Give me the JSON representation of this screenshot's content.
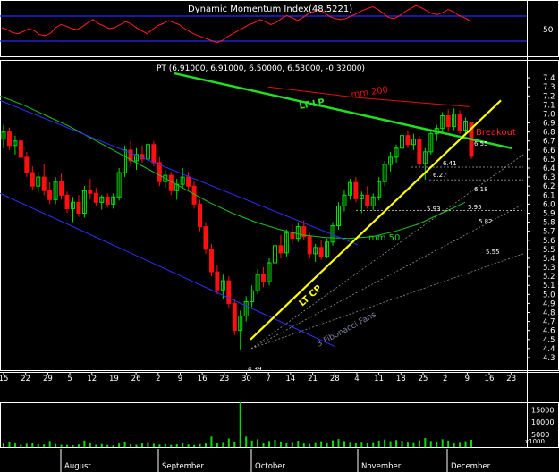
{
  "chart_data": [
    {
      "panel": "momentum",
      "type": "line",
      "title": "Dynamic Momentum Index(48.5221)",
      "ref_label": "50",
      "ylim": [
        0,
        100
      ],
      "upper_band": 75,
      "lower_band": 25,
      "color": "#ff2020",
      "band_color": "#2b2bff",
      "values": [
        52,
        48,
        42,
        40,
        44,
        50,
        46,
        38,
        36,
        40,
        52,
        58,
        55,
        50,
        48,
        54,
        62,
        68,
        60,
        55,
        50,
        52,
        58,
        64,
        60,
        52,
        46,
        40,
        48,
        56,
        60,
        66,
        62,
        58,
        50,
        44,
        38,
        34,
        30,
        26,
        22,
        26,
        34,
        40,
        46,
        52,
        58,
        62,
        68,
        64,
        58,
        62,
        70,
        76,
        72,
        66,
        72,
        80,
        84,
        88,
        82,
        74,
        70,
        68,
        70,
        75,
        80,
        86,
        90,
        94,
        88,
        80,
        72,
        70,
        76,
        84,
        90,
        96,
        92,
        86,
        80,
        78,
        82,
        88,
        84,
        76,
        72,
        66
      ]
    },
    {
      "panel": "price",
      "type": "candlestick",
      "title": "PT (6.91000, 6.91000, 6.50000, 6.53000, -0.32000)",
      "ylim": [
        4.25,
        7.5
      ],
      "y_ticks": [
        "7.4",
        "7.3",
        "7.2",
        "7.1",
        "7.0",
        "6.9",
        "6.8",
        "6.7",
        "6.6",
        "6.5",
        "6.4",
        "6.3",
        "6.2",
        "6.1",
        "6.0",
        "5.9",
        "5.8",
        "5.7",
        "5.6",
        "5.5",
        "5.4",
        "5.3",
        "5.2",
        "5.1",
        "5.0",
        "4.9",
        "4.8",
        "4.7",
        "4.6",
        "4.5",
        "4.4",
        "4.3"
      ],
      "x_ticks": [
        "15",
        "22",
        "29",
        "5",
        "12",
        "19",
        "26",
        "2",
        "9",
        "16",
        "23",
        "30",
        "7",
        "14",
        "21",
        "28",
        "4",
        "11",
        "18",
        "25",
        "2",
        "9",
        "16",
        "23"
      ],
      "months": [
        "August",
        "September",
        "October",
        "November",
        "December"
      ],
      "up_color": "#00e000",
      "down_color": "#ff1010",
      "candles": [
        [
          6.72,
          6.88,
          6.62,
          6.8
        ],
        [
          6.8,
          6.85,
          6.6,
          6.65
        ],
        [
          6.65,
          6.76,
          6.55,
          6.7
        ],
        [
          6.7,
          6.74,
          6.48,
          6.52
        ],
        [
          6.52,
          6.58,
          6.3,
          6.35
        ],
        [
          6.35,
          6.42,
          6.15,
          6.2
        ],
        [
          6.2,
          6.36,
          6.12,
          6.3
        ],
        [
          6.3,
          6.44,
          6.1,
          6.15
        ],
        [
          6.15,
          6.24,
          6.0,
          6.05
        ],
        [
          6.05,
          6.3,
          6.0,
          6.25
        ],
        [
          6.25,
          6.34,
          6.05,
          6.1
        ],
        [
          6.1,
          6.14,
          5.9,
          5.95
        ],
        [
          5.95,
          6.08,
          5.8,
          6.02
        ],
        [
          6.02,
          6.1,
          5.86,
          5.9
        ],
        [
          5.9,
          6.2,
          5.85,
          6.15
        ],
        [
          6.15,
          6.28,
          6.05,
          6.12
        ],
        [
          6.12,
          6.18,
          5.98,
          6.02
        ],
        [
          6.02,
          6.1,
          5.94,
          6.08
        ],
        [
          6.08,
          6.12,
          5.96,
          6.0
        ],
        [
          6.0,
          6.12,
          5.95,
          6.08
        ],
        [
          6.08,
          6.4,
          6.04,
          6.35
        ],
        [
          6.35,
          6.65,
          6.3,
          6.6
        ],
        [
          6.6,
          6.7,
          6.42,
          6.48
        ],
        [
          6.48,
          6.62,
          6.38,
          6.55
        ],
        [
          6.55,
          6.65,
          6.46,
          6.5
        ],
        [
          6.5,
          6.72,
          6.45,
          6.66
        ],
        [
          6.66,
          6.7,
          6.42,
          6.46
        ],
        [
          6.46,
          6.52,
          6.2,
          6.25
        ],
        [
          6.25,
          6.38,
          6.18,
          6.32
        ],
        [
          6.32,
          6.36,
          6.1,
          6.15
        ],
        [
          6.15,
          6.28,
          6.05,
          6.22
        ],
        [
          6.22,
          6.4,
          6.18,
          6.3
        ],
        [
          6.3,
          6.36,
          6.15,
          6.2
        ],
        [
          6.2,
          6.25,
          5.95,
          6.0
        ],
        [
          6.0,
          6.05,
          5.7,
          5.75
        ],
        [
          5.75,
          5.8,
          5.45,
          5.5
        ],
        [
          5.5,
          5.56,
          5.2,
          5.25
        ],
        [
          5.25,
          5.32,
          5.0,
          5.05
        ],
        [
          5.05,
          5.22,
          4.95,
          5.15
        ],
        [
          5.15,
          5.2,
          4.85,
          4.9
        ],
        [
          4.9,
          4.95,
          4.55,
          4.6
        ],
        [
          4.6,
          4.82,
          4.39,
          4.76
        ],
        [
          4.76,
          4.98,
          4.7,
          4.92
        ],
        [
          4.92,
          5.1,
          4.86,
          5.04
        ],
        [
          5.04,
          5.28,
          5.0,
          5.22
        ],
        [
          5.22,
          5.3,
          5.08,
          5.14
        ],
        [
          5.14,
          5.4,
          5.1,
          5.35
        ],
        [
          5.35,
          5.6,
          5.3,
          5.54
        ],
        [
          5.54,
          5.66,
          5.4,
          5.46
        ],
        [
          5.46,
          5.72,
          5.42,
          5.68
        ],
        [
          5.68,
          5.78,
          5.56,
          5.62
        ],
        [
          5.62,
          5.8,
          5.58,
          5.75
        ],
        [
          5.75,
          5.82,
          5.6,
          5.64
        ],
        [
          5.64,
          5.68,
          5.4,
          5.45
        ],
        [
          5.45,
          5.56,
          5.36,
          5.52
        ],
        [
          5.52,
          5.6,
          5.38,
          5.42
        ],
        [
          5.42,
          5.62,
          5.4,
          5.58
        ],
        [
          5.58,
          5.8,
          5.54,
          5.76
        ],
        [
          5.76,
          6.02,
          5.72,
          5.98
        ],
        [
          5.98,
          6.15,
          5.92,
          6.1
        ],
        [
          6.1,
          6.28,
          6.05,
          6.24
        ],
        [
          6.24,
          6.3,
          6.02,
          6.06
        ],
        [
          6.06,
          6.14,
          5.9,
          6.1
        ],
        [
          6.1,
          6.2,
          5.95,
          5.98
        ],
        [
          5.98,
          6.12,
          5.93,
          6.08
        ],
        [
          6.08,
          6.3,
          6.04,
          6.25
        ],
        [
          6.25,
          6.48,
          6.2,
          6.44
        ],
        [
          6.44,
          6.58,
          6.36,
          6.52
        ],
        [
          6.52,
          6.66,
          6.46,
          6.62
        ],
        [
          6.62,
          6.8,
          6.58,
          6.76
        ],
        [
          6.76,
          6.82,
          6.62,
          6.66
        ],
        [
          6.66,
          6.78,
          6.6,
          6.72
        ],
        [
          6.72,
          6.76,
          6.41,
          6.45
        ],
        [
          6.45,
          6.62,
          6.27,
          6.58
        ],
        [
          6.58,
          6.82,
          6.55,
          6.78
        ],
        [
          6.78,
          6.88,
          6.7,
          6.84
        ],
        [
          6.84,
          7.02,
          6.8,
          6.98
        ],
        [
          6.98,
          7.05,
          6.8,
          6.86
        ],
        [
          6.86,
          7.06,
          6.82,
          7.0
        ],
        [
          7.0,
          7.04,
          6.78,
          6.82
        ],
        [
          6.82,
          6.96,
          6.76,
          6.92
        ],
        [
          6.91,
          6.91,
          6.5,
          6.53
        ]
      ],
      "ma200_label": "mm 200",
      "ma50_label": "mm 50",
      "ma200_color": "#e01010",
      "ma50_color": "#20c020",
      "ma200": [
        7.3,
        7.27,
        7.24,
        7.21,
        7.18,
        7.16,
        7.14,
        7.12,
        7.1,
        7.08
      ],
      "ma50": [
        7.2,
        7.1,
        6.98,
        6.86,
        6.72,
        6.58,
        6.44,
        6.3,
        6.16,
        6.02,
        5.9,
        5.8,
        5.72,
        5.66,
        5.63,
        5.62,
        5.64,
        5.7,
        5.78,
        5.9,
        6.02
      ],
      "annotations": {
        "lt_lp": "LT LP",
        "lt_cp": "LT CP",
        "breakout": "Breakout",
        "fib": "3 Fibonacci Fans",
        "low": "4.39",
        "v655": "6.55",
        "v641": "6.41",
        "v627": "6.27",
        "v618": "6.18",
        "v593": "5.93",
        "v595": "5.95",
        "v582": "5.82",
        "v555": "5.55"
      }
    },
    {
      "panel": "volume",
      "type": "bar",
      "y_ticks": [
        "15000",
        "10000",
        "5000"
      ],
      "unit": "x1000",
      "ylim": [
        0,
        18000
      ],
      "color": "#00e000",
      "values": [
        1800,
        2200,
        1400,
        900,
        1300,
        1600,
        1100,
        1000,
        2400,
        1200,
        900,
        800,
        700,
        1000,
        2600,
        1500,
        900,
        1200,
        800,
        700,
        1400,
        2200,
        1100,
        900,
        1600,
        2000,
        1300,
        1000,
        1200,
        900,
        1100,
        1500,
        1000,
        800,
        1200,
        1400,
        4200,
        1800,
        2000,
        3400,
        2200,
        18000,
        4200,
        2600,
        3100,
        1800,
        2400,
        2900,
        2200,
        1600,
        2000,
        2500,
        1400,
        1200,
        1900,
        2300,
        1700,
        2700,
        3200,
        2400,
        2000,
        1600,
        2100,
        1700,
        1900,
        2600,
        3000,
        2300,
        2800,
        2500,
        2100,
        1900,
        2700,
        3600,
        2400,
        2200,
        3100,
        2600,
        1800,
        2000,
        2300,
        2900
      ]
    }
  ]
}
